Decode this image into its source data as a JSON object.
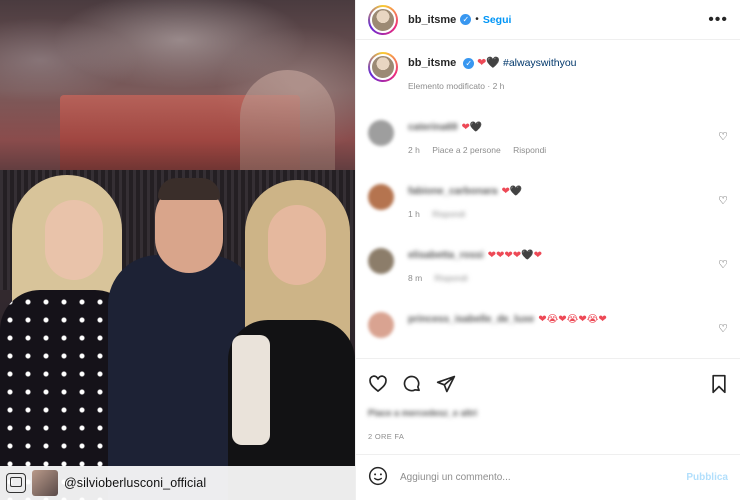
{
  "photo": {
    "repost_handle": "@silvioberlusconi_official"
  },
  "post": {
    "username": "bb_itsme",
    "follow_label": "Segui",
    "more_label": "•••",
    "dot": "•"
  },
  "caption": {
    "username": "bb_itsme",
    "hearts": "❤🖤",
    "hashtag": "#alwayswithyou",
    "edited": "Elemento modificato · 2 h"
  },
  "comments": [
    {
      "name": "caterina69",
      "hearts": "❤🖤",
      "time": "2 h",
      "likes": "Piace a 2 persone",
      "reply": "Rispondi",
      "avatar_color": "#9e9e9e"
    },
    {
      "name": "fabione_carbonara",
      "hearts": "❤🖤",
      "time": "1 h",
      "likes": "",
      "reply": "Rispondi",
      "avatar_color": "#b5744f"
    },
    {
      "name": "elisabetta_rossi",
      "hearts": "❤❤❤❤🖤❤",
      "time": "8 m",
      "likes": "",
      "reply": "Rispondi",
      "avatar_color": "#8c7d6a"
    },
    {
      "name": "princess_isabelle_de_luxe",
      "hearts": "❤😭❤😭❤😭❤",
      "time": "",
      "likes": "",
      "reply": "",
      "avatar_color": "#d9a391"
    }
  ],
  "footer": {
    "liked_by": "Piace a mercedesz_e altri",
    "time_ago": "2 ORE FA",
    "comment_placeholder": "Aggiungi un commento...",
    "publish_label": "Pubblica"
  }
}
